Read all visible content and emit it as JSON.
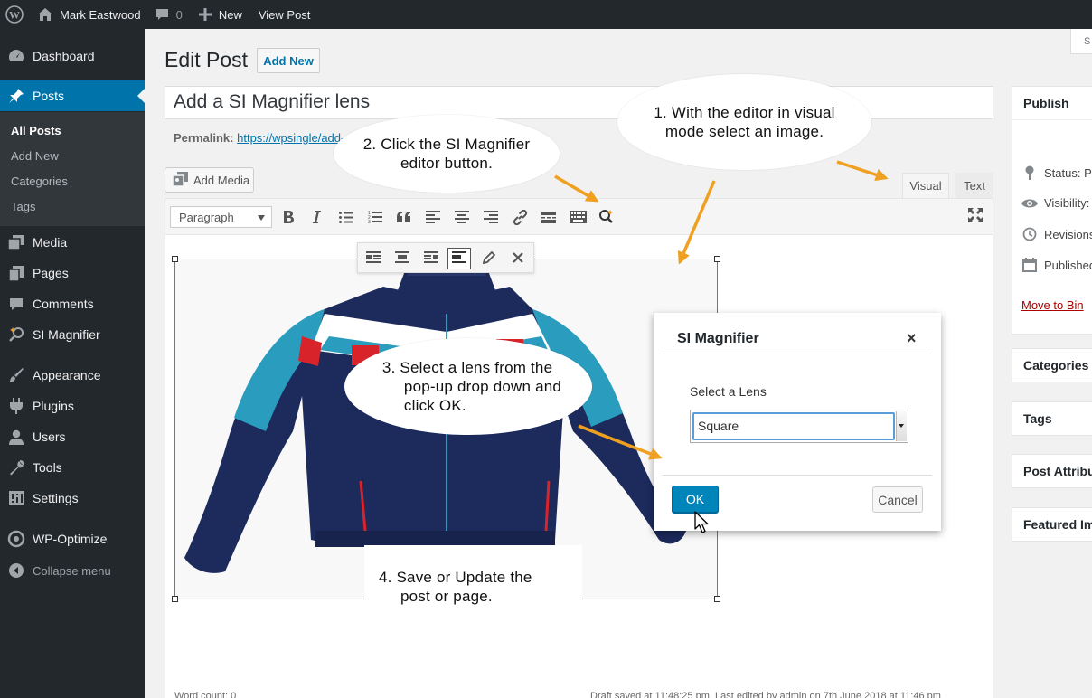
{
  "admin_bar": {
    "site_name": "Mark Eastwood",
    "comments_count": "0",
    "new_label": "New",
    "view_post_label": "View Post"
  },
  "sidebar": {
    "items": [
      {
        "label": "Dashboard",
        "icon": "dashboard-icon"
      },
      {
        "label": "Posts",
        "icon": "pin-icon",
        "current": true
      },
      {
        "label": "Media",
        "icon": "media-icon"
      },
      {
        "label": "Pages",
        "icon": "pages-icon"
      },
      {
        "label": "Comments",
        "icon": "comment-icon"
      },
      {
        "label": "SI Magnifier",
        "icon": "magnifier-icon"
      },
      {
        "label": "Appearance",
        "icon": "brush-icon"
      },
      {
        "label": "Plugins",
        "icon": "plug-icon"
      },
      {
        "label": "Users",
        "icon": "user-icon"
      },
      {
        "label": "Tools",
        "icon": "wrench-icon"
      },
      {
        "label": "Settings",
        "icon": "settings-icon"
      },
      {
        "label": "WP-Optimize",
        "icon": "optimize-icon"
      }
    ],
    "submenu": [
      "All Posts",
      "Add New",
      "Categories",
      "Tags"
    ],
    "collapse_label": "Collapse menu"
  },
  "screen_options_label": "S",
  "page": {
    "heading": "Edit Post",
    "add_new_label": "Add New",
    "post_title": "Add a SI Magnifier lens",
    "permalink_label": "Permalink:",
    "permalink_url": "https://wpsingle/add-..."
  },
  "editor": {
    "add_media_label": "Add Media",
    "tab_visual": "Visual",
    "tab_text": "Text",
    "format_value": "Paragraph",
    "word_count": "Word count: 0",
    "draft_status": "Draft saved at 11:48:25 pm. Last edited by admin on 7th June 2018 at 11:46 pm"
  },
  "side_panel": {
    "publish_title": "Publish",
    "status_label": "Status: Pu",
    "visibility_label": "Visibility:",
    "revisions_label": "Revisions",
    "published_label": "Published",
    "move_to_bin": "Move to Bin",
    "boxes": [
      "Categories",
      "Tags",
      "Post Attribu",
      "Featured Im"
    ]
  },
  "modal": {
    "title": "SI Magnifier",
    "close": "×",
    "select_label": "Select a Lens",
    "select_value": "Square",
    "ok_label": "OK",
    "cancel_label": "Cancel"
  },
  "annotations": {
    "step1": [
      "1. With the editor in visual",
      "mode select an image."
    ],
    "step2": [
      "2. Click the SI Magnifier",
      "editor button."
    ],
    "step3": [
      "3. Select a lens from the",
      "pop-up drop down and",
      "click OK."
    ],
    "step4": [
      "4. Save or Update the",
      "post or page."
    ]
  },
  "colors": {
    "admin_bg": "#23282d",
    "accent_blue": "#0073aa",
    "arrow_orange": "#f0a020",
    "ok_button": "#0085ba"
  }
}
